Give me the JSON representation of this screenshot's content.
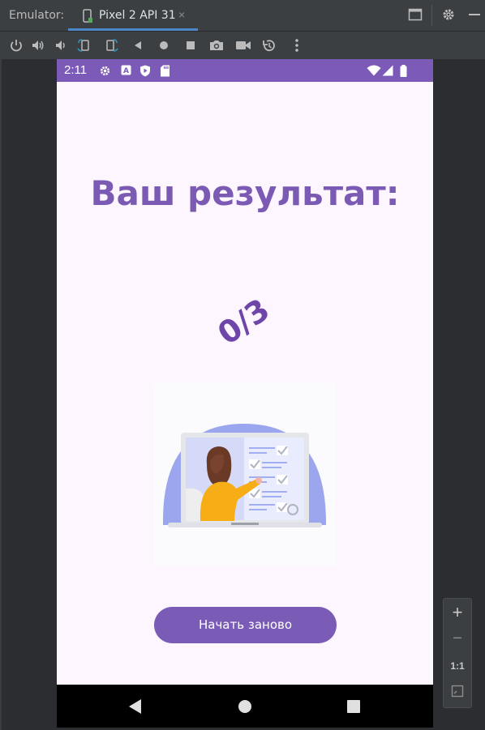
{
  "emulator": {
    "panel_label": "Emulator:",
    "device_tab": "Pixel 2 API 31",
    "tab_close": "×",
    "toolbar_icons": [
      "power-icon",
      "volume-up-icon",
      "volume-down-icon",
      "rotate-left-icon",
      "rotate-right-icon",
      "back-icon",
      "home-icon",
      "overview-icon",
      "camera-icon",
      "video-icon",
      "snapshot-icon",
      "more-icon"
    ],
    "zoom": {
      "plus": "+",
      "minus": "−",
      "one_to_one": "1:1"
    }
  },
  "status_bar": {
    "time": "2:11",
    "background": "#7c5ab8"
  },
  "screen": {
    "title": "Ваш результат:",
    "score": "0/3",
    "restart_button": "Начать заново",
    "accent_color": "#7a5ab3"
  },
  "illustration": {
    "subject": "woman-at-laptop-checklist"
  }
}
